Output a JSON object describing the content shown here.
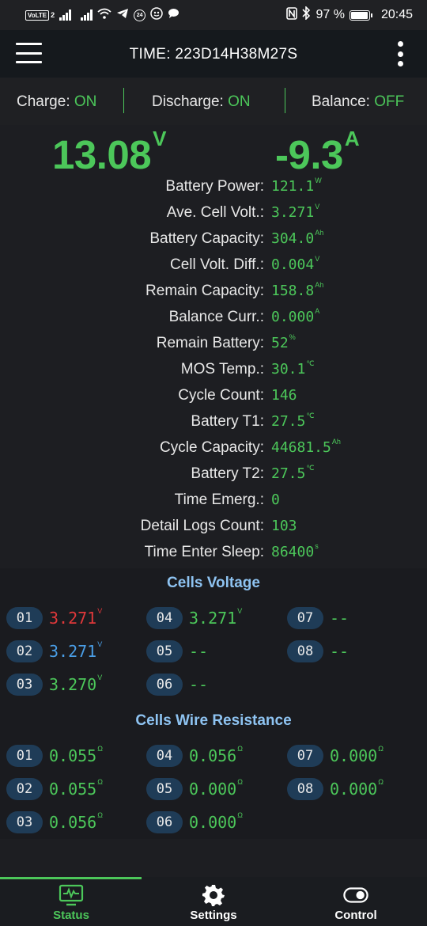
{
  "statusbar": {
    "volte": "VoLTE",
    "sim_index": "2",
    "badge_number": "24",
    "battery_percent": "97 %",
    "battery_level": 0.97,
    "time": "20:45"
  },
  "appbar": {
    "title": "TIME: 223D14H38M27S"
  },
  "switches": {
    "charge_label": "Charge: ",
    "charge_value": "ON",
    "discharge_label": "Discharge: ",
    "discharge_value": "ON",
    "balance_label": "Balance: ",
    "balance_value": "OFF"
  },
  "main": {
    "voltage": "13.08",
    "voltage_unit": "V",
    "current": "-9.3",
    "current_unit": "A"
  },
  "info": [
    {
      "label": "Battery Power:",
      "value": "121.1",
      "unit": "W"
    },
    {
      "label": "Ave. Cell Volt.:",
      "value": "3.271",
      "unit": "V"
    },
    {
      "label": "Battery Capacity:",
      "value": "304.0",
      "unit": "Ah"
    },
    {
      "label": "Cell Volt. Diff.:",
      "value": "0.004",
      "unit": "V"
    },
    {
      "label": "Remain Capacity:",
      "value": "158.8",
      "unit": "Ah"
    },
    {
      "label": "Balance Curr.:",
      "value": "0.000",
      "unit": "A"
    },
    {
      "label": "Remain Battery:",
      "value": "52",
      "unit": "%"
    },
    {
      "label": "MOS Temp.:",
      "value": "30.1",
      "unit": "℃"
    },
    {
      "label": "Cycle Count:",
      "value": "146",
      "unit": ""
    },
    {
      "label": "Battery T1:",
      "value": "27.5",
      "unit": "℃"
    },
    {
      "label": "Cycle Capacity:",
      "value": "44681.5",
      "unit": "Ah"
    },
    {
      "label": "Battery T2:",
      "value": "27.5",
      "unit": "℃"
    },
    {
      "label": "Time Emerg.:",
      "value": "0",
      "unit": ""
    },
    {
      "label": "Detail Logs Count:",
      "value": "103",
      "unit": ""
    },
    {
      "label": "Time Enter Sleep:",
      "value": "86400",
      "unit": "s"
    }
  ],
  "cells_voltage": {
    "title": "Cells Voltage",
    "cells": [
      {
        "id": "01",
        "value": "3.271",
        "unit": "V",
        "color": "#e0383a"
      },
      {
        "id": "02",
        "value": "3.271",
        "unit": "V",
        "color": "#4a9ee6"
      },
      {
        "id": "03",
        "value": "3.270",
        "unit": "V",
        "color": "#4cc75a"
      },
      {
        "id": "04",
        "value": "3.271",
        "unit": "V",
        "color": "#4cc75a"
      },
      {
        "id": "05",
        "value": "--",
        "unit": "",
        "color": "#4cc75a"
      },
      {
        "id": "06",
        "value": "--",
        "unit": "",
        "color": "#4cc75a"
      },
      {
        "id": "07",
        "value": "--",
        "unit": "",
        "color": "#4cc75a"
      },
      {
        "id": "08",
        "value": "--",
        "unit": "",
        "color": "#4cc75a"
      }
    ]
  },
  "cells_resistance": {
    "title": "Cells Wire Resistance",
    "cells": [
      {
        "id": "01",
        "value": "0.055",
        "unit": "Ω"
      },
      {
        "id": "02",
        "value": "0.055",
        "unit": "Ω"
      },
      {
        "id": "03",
        "value": "0.056",
        "unit": "Ω"
      },
      {
        "id": "04",
        "value": "0.056",
        "unit": "Ω"
      },
      {
        "id": "05",
        "value": "0.000",
        "unit": "Ω"
      },
      {
        "id": "06",
        "value": "0.000",
        "unit": "Ω"
      },
      {
        "id": "07",
        "value": "0.000",
        "unit": "Ω"
      },
      {
        "id": "08",
        "value": "0.000",
        "unit": "Ω"
      }
    ]
  },
  "bottomnav": {
    "items": [
      {
        "label": "Status",
        "icon": "monitor-pulse-icon",
        "active": true
      },
      {
        "label": "Settings",
        "icon": "gear-icon",
        "active": false
      },
      {
        "label": "Control",
        "icon": "toggle-icon",
        "active": false
      }
    ]
  },
  "colors": {
    "accent_green": "#4cc75a",
    "title_blue": "#8ec3f1",
    "badge_bg": "#1f3c57",
    "alert_red": "#e0383a",
    "cell_blue": "#4a9ee6"
  }
}
